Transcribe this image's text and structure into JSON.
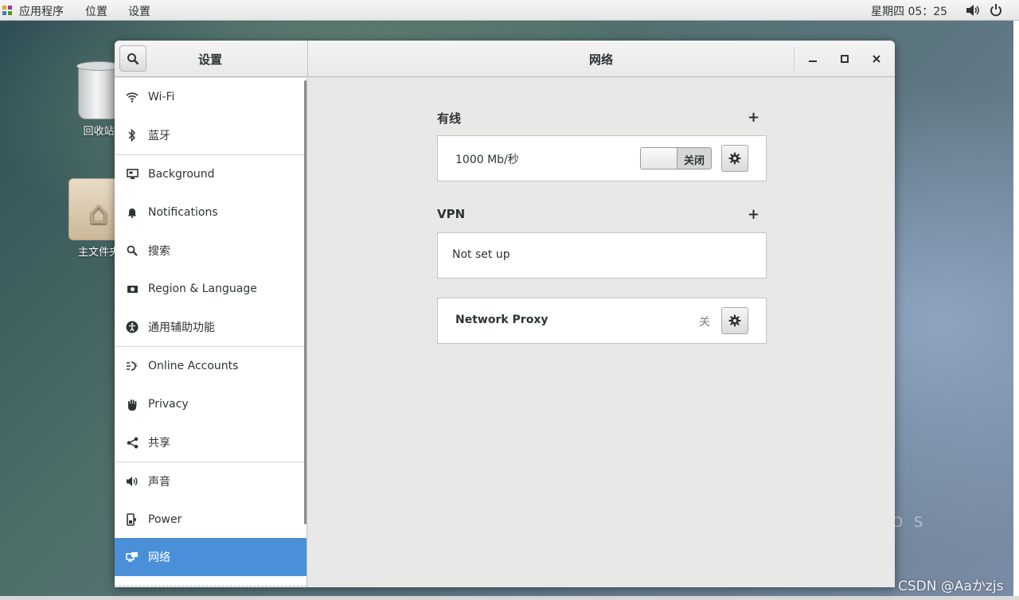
{
  "top_panel": {
    "apps_label": "应用程序",
    "places_label": "位置",
    "settings_label": "设置",
    "clock": "星期四 05：25"
  },
  "desktop": {
    "trash_label": "回收站",
    "home_label": "主文件夹",
    "logo_text": "O S",
    "watermark": "CSDN @Aaかzjs"
  },
  "window": {
    "sidebar_title": "设置",
    "panel_title": "网络"
  },
  "sidebar": {
    "items": [
      {
        "label": "Wi-Fi",
        "icon": "wifi-icon"
      },
      {
        "label": "蓝牙",
        "icon": "bluetooth-icon"
      },
      {
        "label": "Background",
        "icon": "background-icon"
      },
      {
        "label": "Notifications",
        "icon": "bell-icon"
      },
      {
        "label": "搜索",
        "icon": "search-icon"
      },
      {
        "label": "Region & Language",
        "icon": "camera-icon"
      },
      {
        "label": "通用辅助功能",
        "icon": "accessibility-icon"
      },
      {
        "label": "Online Accounts",
        "icon": "online-accounts-icon"
      },
      {
        "label": "Privacy",
        "icon": "hand-icon"
      },
      {
        "label": "共享",
        "icon": "share-icon"
      },
      {
        "label": "声音",
        "icon": "speaker-icon"
      },
      {
        "label": "Power",
        "icon": "power-plug-icon"
      },
      {
        "label": "网络",
        "icon": "network-icon"
      }
    ],
    "selected": "网络"
  },
  "network": {
    "wired": {
      "title": "有线",
      "add_label": "+",
      "speed": "1000 Mb/秒",
      "switch_label": "关闭",
      "switch_on": false
    },
    "vpn": {
      "title": "VPN",
      "add_label": "+",
      "status": "Not set up"
    },
    "proxy": {
      "label": "Network Proxy",
      "state": "关"
    }
  },
  "colors": {
    "accent": "#4a90d9",
    "window_bg": "#e8e8e7",
    "sidebar_bg": "#ffffff"
  }
}
